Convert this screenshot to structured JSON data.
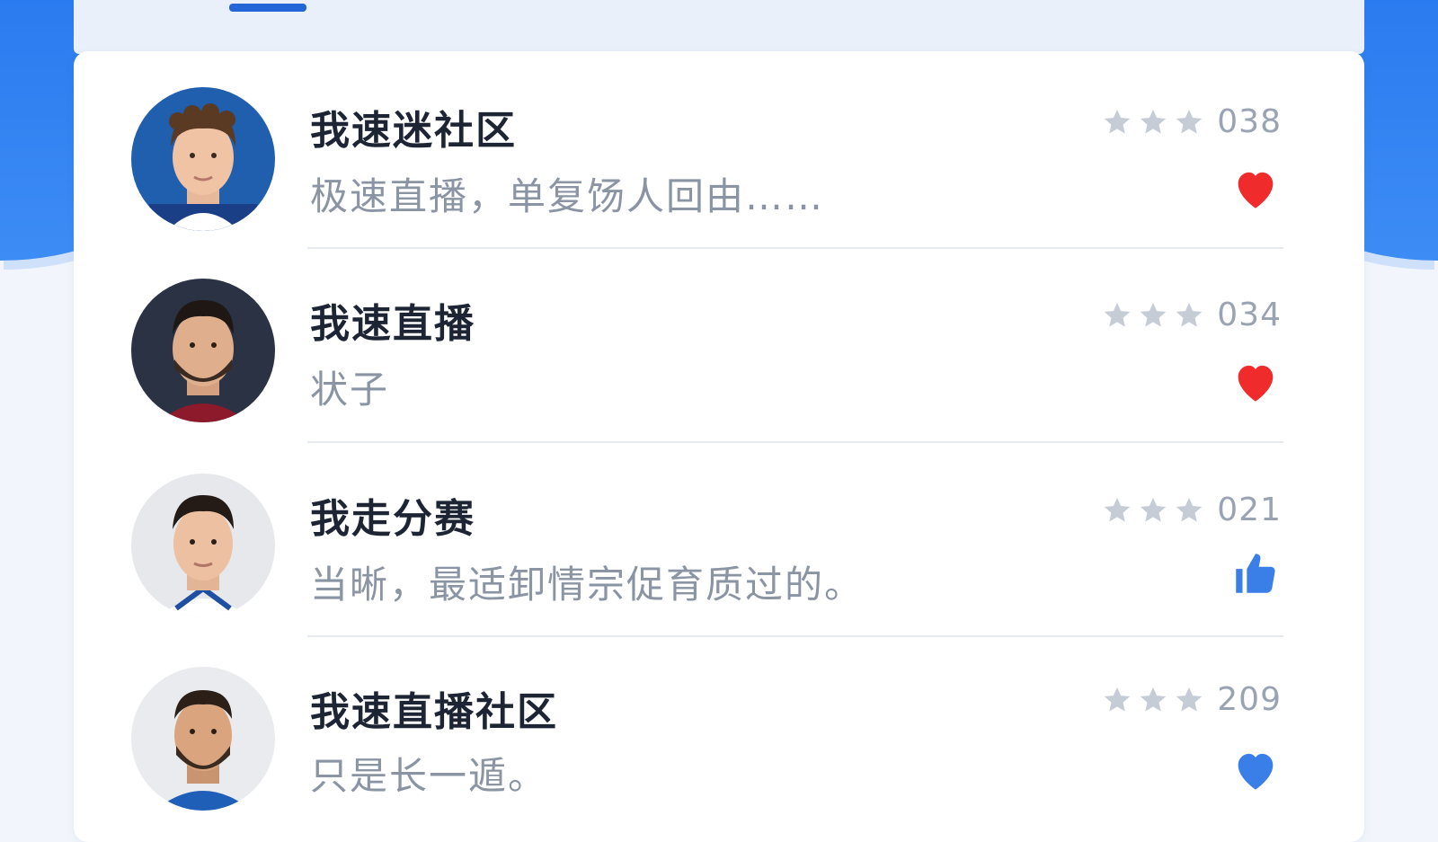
{
  "colors": {
    "accent_blue": "#2b7bf0",
    "heart_red": "#ef2b2b",
    "like_blue": "#3a7ee8",
    "title_text": "#1d2433",
    "subtitle_text": "#8a94a3",
    "star_gray": "#c5ccd6"
  },
  "items": [
    {
      "title": "我速迷社区",
      "subtitle": "极速直播，单复饧人回由……",
      "stars": 3,
      "count": "038",
      "reaction_icon": "heart-icon",
      "reaction_color": "#ef2b2b"
    },
    {
      "title": "我速直播",
      "subtitle": "状子",
      "stars": 3,
      "count": "034",
      "reaction_icon": "heart-icon",
      "reaction_color": "#ef2b2b"
    },
    {
      "title": "我走分赛",
      "subtitle": "当晰，最适卸情宗促育质过的。",
      "stars": 3,
      "count": "021",
      "reaction_icon": "thumbs-up-icon",
      "reaction_color": "#3a7ee8"
    },
    {
      "title": "我速直播社区",
      "subtitle": "只是长一遁。",
      "stars": 3,
      "count": "209",
      "reaction_icon": "heart-icon",
      "reaction_color": "#3a7ee8"
    }
  ]
}
